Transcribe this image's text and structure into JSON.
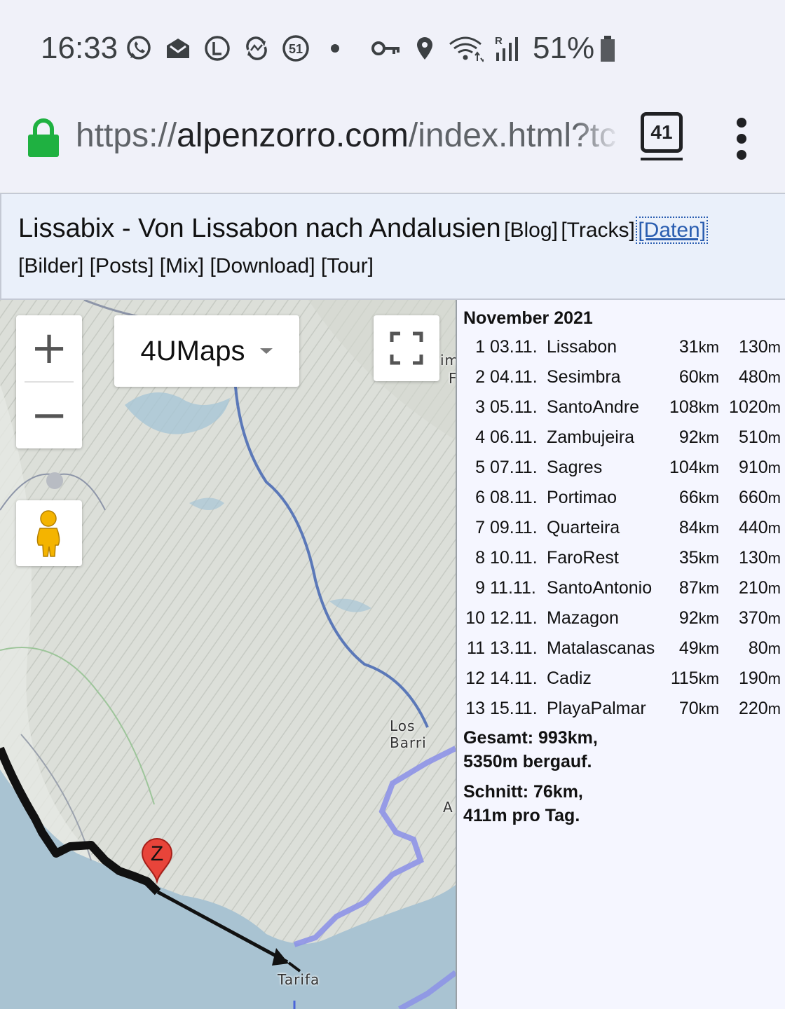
{
  "status_bar": {
    "time": "16:33",
    "notification_icons": [
      "whatsapp-icon",
      "mail-icon",
      "l-circle-icon",
      "sync-icon",
      "badge-51-icon",
      "dot-icon"
    ],
    "badge_number": "51",
    "system_icons": [
      "vpn-key-icon",
      "location-icon",
      "wifi-icon",
      "signal-roaming-icon",
      "battery-icon"
    ],
    "roaming_label": "R",
    "battery_percent": "51%"
  },
  "browser": {
    "url_scheme": "https://",
    "url_domain": "alpenzorro.com",
    "url_path": "/index.html?tc",
    "tab_count": "41",
    "secure_color": "#1fb141"
  },
  "header": {
    "title": "Lissabix - Von Lissabon nach Andalusien",
    "links_line1": [
      "[Blog]",
      "[Tracks]",
      "[Daten]"
    ],
    "active_link": "[Daten]",
    "links_line2": [
      "[Bilder]",
      "[Posts]",
      "[Mix]",
      "[Download]",
      "[Tour]"
    ]
  },
  "map": {
    "zoom_in": "+",
    "zoom_out": "−",
    "map_type": "4UMaps",
    "marker_letter": "Z",
    "labels": [
      "Los Barri",
      "Tarifa",
      "A",
      "im",
      "F"
    ]
  },
  "stats": {
    "month": "November 2021",
    "rows": [
      {
        "n": "1",
        "date": "03.11.",
        "place": "Lissabon",
        "km": "31",
        "m": "130"
      },
      {
        "n": "2",
        "date": "04.11.",
        "place": "Sesimbra",
        "km": "60",
        "m": "480"
      },
      {
        "n": "3",
        "date": "05.11.",
        "place": "SantoAndre",
        "km": "108",
        "m": "1020"
      },
      {
        "n": "4",
        "date": "06.11.",
        "place": "Zambujeira",
        "km": "92",
        "m": "510"
      },
      {
        "n": "5",
        "date": "07.11.",
        "place": "Sagres",
        "km": "104",
        "m": "910"
      },
      {
        "n": "6",
        "date": "08.11.",
        "place": "Portimao",
        "km": "66",
        "m": "660"
      },
      {
        "n": "7",
        "date": "09.11.",
        "place": "Quarteira",
        "km": "84",
        "m": "440"
      },
      {
        "n": "8",
        "date": "10.11.",
        "place": "FaroRest",
        "km": "35",
        "m": "130"
      },
      {
        "n": "9",
        "date": "11.11.",
        "place": "SantoAntonio",
        "km": "87",
        "m": "210"
      },
      {
        "n": "10",
        "date": "12.11.",
        "place": "Mazagon",
        "km": "92",
        "m": "370"
      },
      {
        "n": "11",
        "date": "13.11.",
        "place": "Matalascanas",
        "km": "49",
        "m": "80"
      },
      {
        "n": "12",
        "date": "14.11.",
        "place": "Cadiz",
        "km": "115",
        "m": "190"
      },
      {
        "n": "13",
        "date": "15.11.",
        "place": "PlayaPalmar",
        "km": "70",
        "m": "220"
      }
    ],
    "km_unit": "km",
    "m_unit": "m",
    "total_line1": "Gesamt: 993km,",
    "total_line2": "5350m bergauf.",
    "avg_line1": "Schnitt: 76km,",
    "avg_line2": "411m pro Tag."
  }
}
